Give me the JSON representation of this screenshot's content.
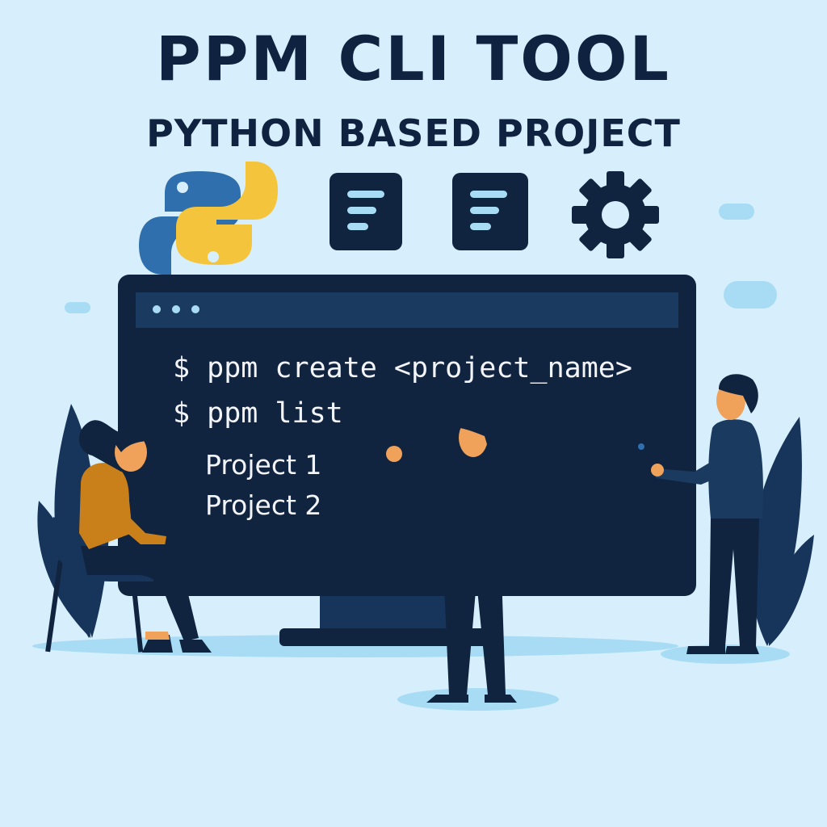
{
  "header": {
    "title": "PPM CLI TOOL",
    "subtitle": "PYTHON BASED PROJECT"
  },
  "icons": [
    "python-logo",
    "document-icon",
    "document-icon",
    "gear-icon"
  ],
  "terminal": {
    "commands": [
      "$ ppm create <project_name>",
      "$ ppm list"
    ],
    "output": [
      "Project 1",
      "Project 2"
    ]
  },
  "colors": {
    "background": "#d7effc",
    "navy": "#0f2340",
    "screen": "#10243f",
    "python_blue": "#2f6fad",
    "python_yellow": "#f4c53c",
    "accent_orange": "#d98a1e"
  }
}
